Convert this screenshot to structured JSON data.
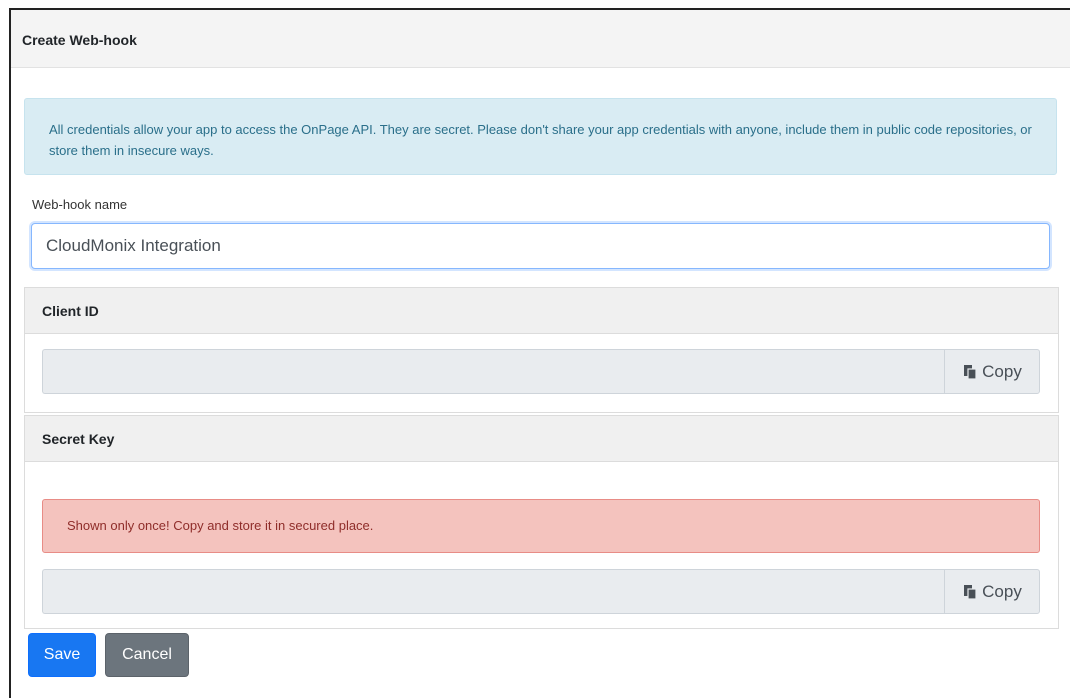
{
  "header": {
    "title": "Create Web-hook"
  },
  "info_alert": {
    "text": "All credentials allow your app to access the OnPage API. They are secret. Please don't share your app credentials with anyone, include them in public code repositories, or store them in insecure ways."
  },
  "name_field": {
    "label": "Web-hook name",
    "value": "CloudMonix Integration"
  },
  "client_id": {
    "title": "Client ID",
    "value": "",
    "copy_label": "Copy"
  },
  "secret_key": {
    "title": "Secret Key",
    "warning": "Shown only once! Copy and store it in secured place.",
    "value": "",
    "copy_label": "Copy"
  },
  "actions": {
    "save_label": "Save",
    "cancel_label": "Cancel"
  },
  "colors": {
    "primary": "#1877f2",
    "secondary": "#6c757d",
    "info_bg": "#d9ecf3",
    "danger_bg": "#f4c3be"
  },
  "icons": {
    "copy": "copy-icon"
  }
}
